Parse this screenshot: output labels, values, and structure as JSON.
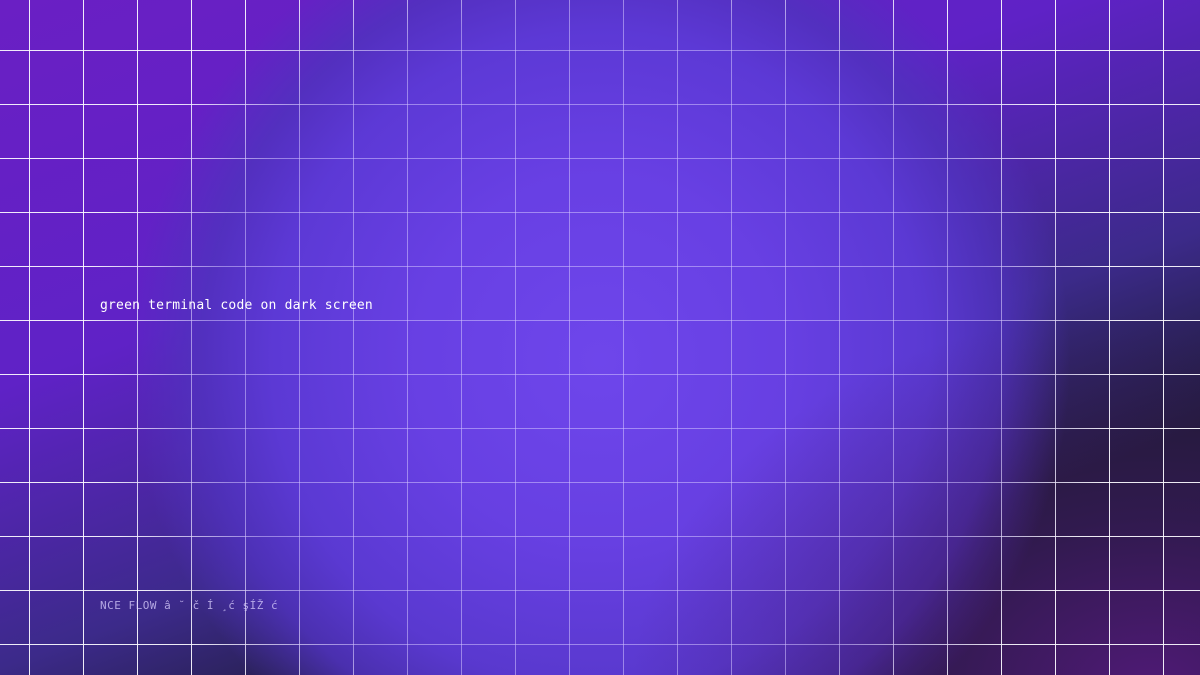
{
  "main": {
    "caption": "green terminal code on dark screen",
    "footer_text": "NCE FLOW â ˘ č  Í ¸ć şÍŽ ć"
  }
}
